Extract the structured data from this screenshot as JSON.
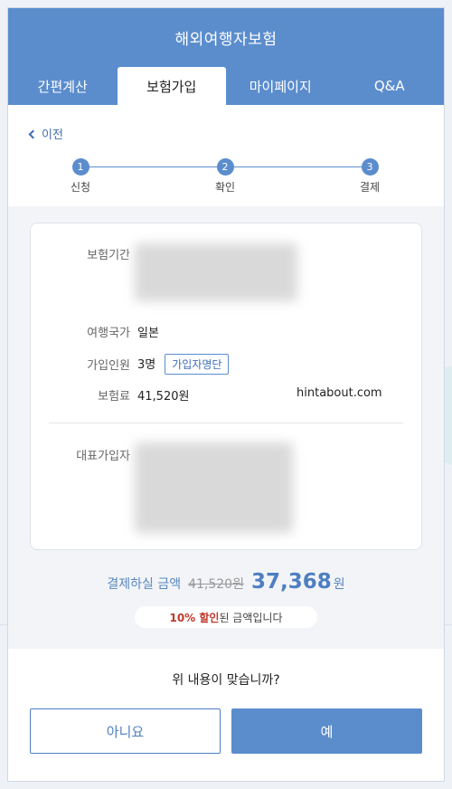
{
  "header": {
    "title": "해외여행자보험"
  },
  "tabs": [
    {
      "label": "간편계산",
      "active": false
    },
    {
      "label": "보험가입",
      "active": true
    },
    {
      "label": "마이페이지",
      "active": false
    },
    {
      "label": "Q&A",
      "active": false
    }
  ],
  "nav": {
    "back_label": "이전"
  },
  "steps": [
    {
      "num": "1",
      "label": "신청"
    },
    {
      "num": "2",
      "label": "확인"
    },
    {
      "num": "3",
      "label": "결제"
    }
  ],
  "summary": {
    "period_label": "보험기간",
    "country_label": "여행국가",
    "country_value": "일본",
    "members_label": "가입인원",
    "members_value": "3명",
    "members_button": "가입자명단",
    "premium_label": "보험료",
    "premium_value": "41,520원",
    "watermark": "hintabout.com",
    "representative_label": "대표가입자"
  },
  "payment": {
    "label": "결제하실 금액",
    "original": "41,520원",
    "discounted": "37,368",
    "unit": "원",
    "discount_highlight": "10% 할인",
    "discount_rest": "된 금액입니다"
  },
  "confirm": {
    "question": "위 내용이 맞습니까?",
    "no_label": "아니요",
    "yes_label": "예"
  },
  "colors": {
    "primary": "#5b8dcd",
    "accent_text": "#3e6db5",
    "discount": "#c0392b"
  }
}
